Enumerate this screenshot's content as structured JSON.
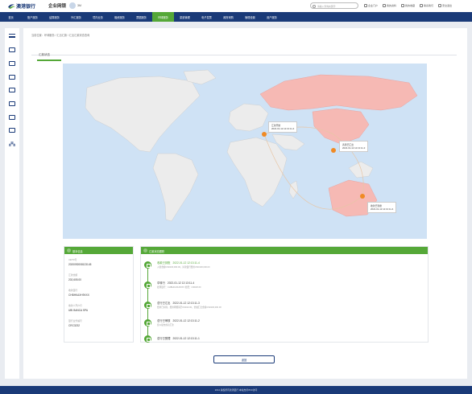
{
  "header": {
    "brand": "企业网银",
    "bank_name": "澳港银行",
    "user_name": "3M",
    "search_placeholder": "请输入查询关键字",
    "links": [
      "企业门户",
      "我的资料",
      "我的收藏",
      "联系我们",
      "安全退出"
    ]
  },
  "nav": {
    "items": [
      "首页",
      "账户服务",
      "结算服务",
      "外汇服务",
      "境内业务",
      "融资服务",
      "票据服务",
      "环球服务",
      "渠道管理",
      "电子发票",
      "政府采购",
      "管理设置",
      "用户服务"
    ],
    "active_index": 7
  },
  "breadcrumb": "当前位置：环球服务 / 汇出汇款 / 汇出汇款状态查询",
  "tab": {
    "label": "汇款状态"
  },
  "map": {
    "markers": [
      {
        "label": "汇款开始",
        "time": "2022-01-12 12:13:11-4"
      },
      {
        "label": "香港已汇出",
        "time": "2022-01-12 12:13:11-3"
      },
      {
        "label": "收款已到账",
        "time": "2022-01-12 12:13:11-4"
      }
    ],
    "highlight_color": "#f6b9b4",
    "land_color": "#ececec",
    "sea_color": "#cfe2f5",
    "marker_color": "#f08a24"
  },
  "info_card": {
    "title": "基本信息",
    "fields": [
      {
        "label": "UETR号",
        "value": "2020092008123145"
      },
      {
        "label": "汇款金额",
        "value": "202,605.00"
      },
      {
        "label": "收款银行",
        "value": "CHBHKAXH9XXX"
      },
      {
        "label": "收款人开户行",
        "value": "UBI BANCA SPA"
      },
      {
        "label": "银行业务编号",
        "value": "CRC3232"
      }
    ]
  },
  "timeline_card": {
    "title": "汇款状态跟踪",
    "events": [
      {
        "title": "收款已到账",
        "time": "2022-01-12 12:13:11-4",
        "desc": "入账金额USD100,000.00，扣款银行费用USD100,000.00"
      },
      {
        "title": "中转行",
        "time": "2022-01-12 12:13:11-4",
        "desc": "处理银行：CHBHKAXH9XXX 处费：USD20.00"
      },
      {
        "title": "总行已汇出",
        "time": "2022-01-12 12:13:11-3",
        "desc": "费用已扣除，费用明细请至USD10.00，金融汇出金额USD100,000.00"
      },
      {
        "title": "总行已审核",
        "time": "2022-01-12 12:13:11-2",
        "desc": "您以提交成功汇款"
      },
      {
        "title": "总行已受理",
        "time": "2022-01-12 12:13:11-1",
        "desc": ""
      }
    ]
  },
  "buttons": {
    "back": "返回"
  },
  "footer": "2014 版权所有澳港银行 本站支持IPv6访问"
}
